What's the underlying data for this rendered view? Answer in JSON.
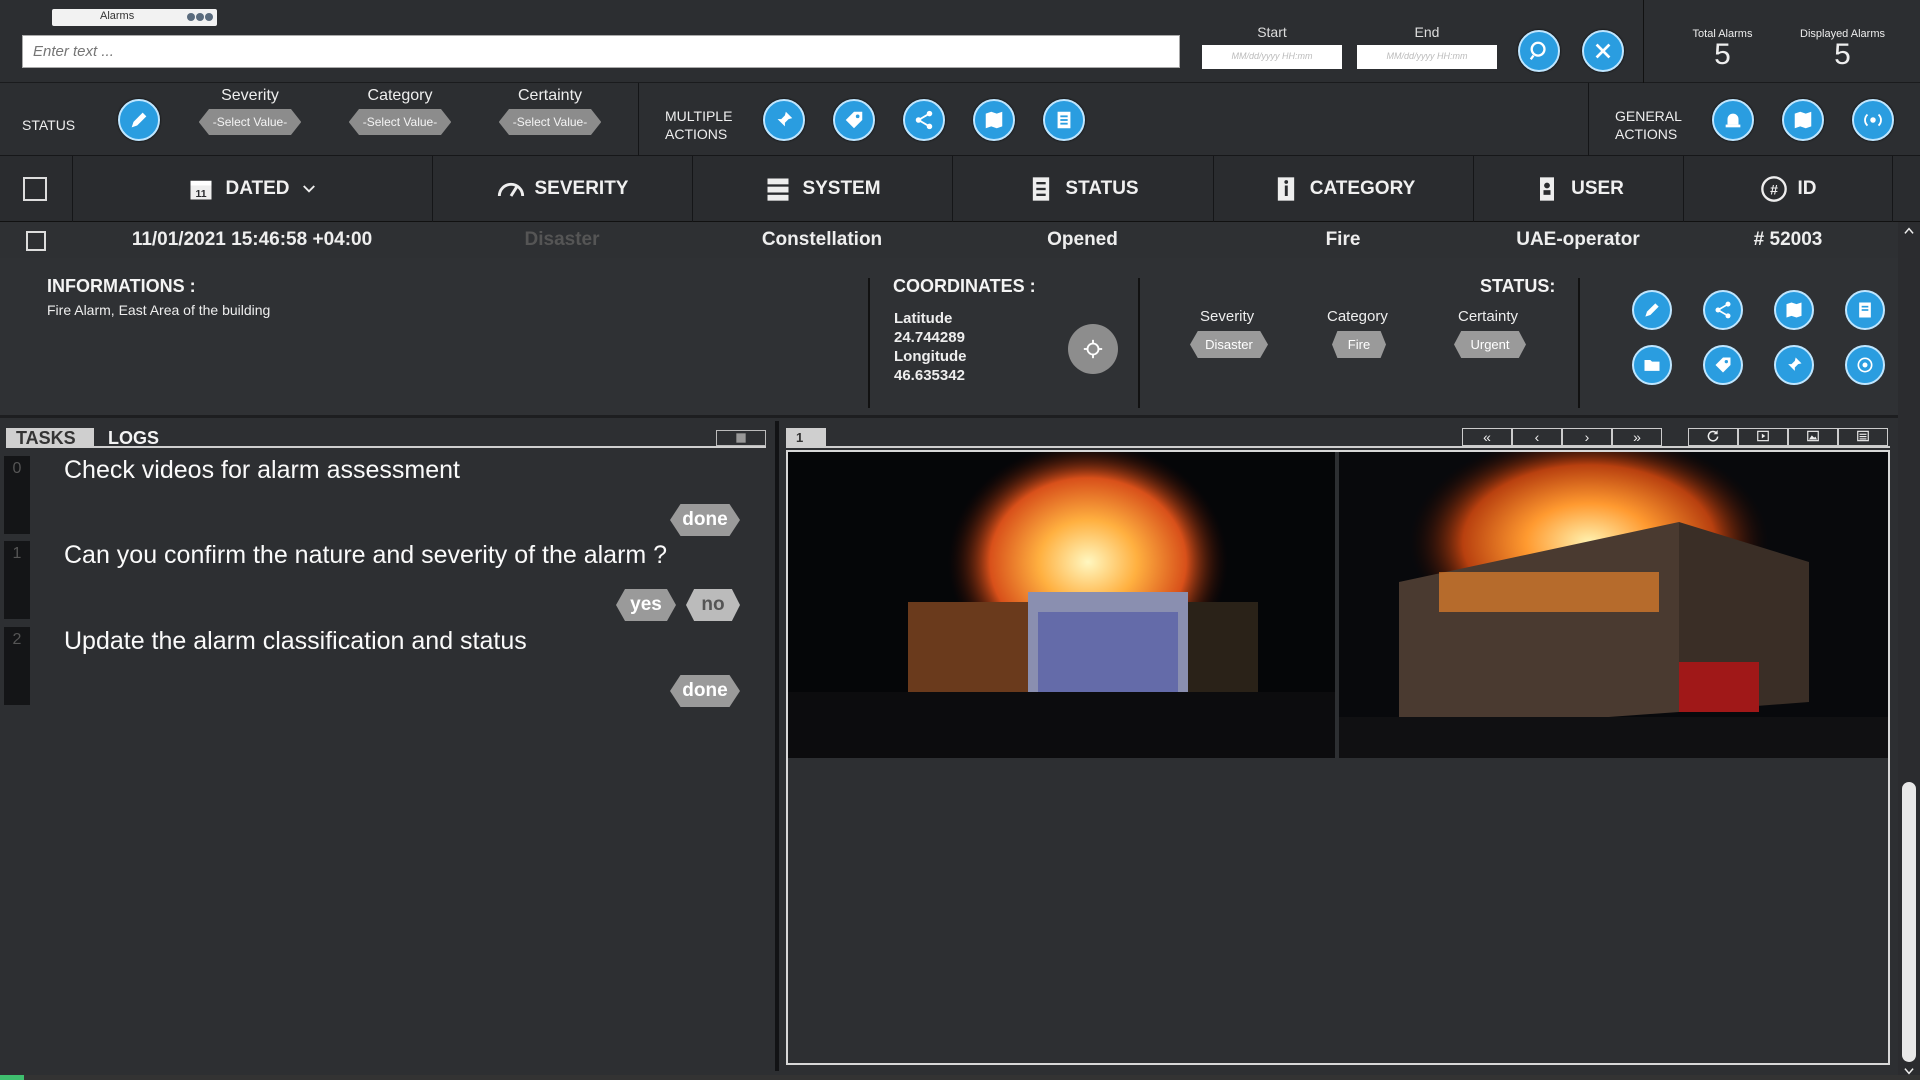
{
  "top": {
    "tab_label": "Alarms",
    "search_placeholder": "Enter text ...",
    "start_label": "Start",
    "end_label": "End",
    "start_placeholder": "MM/dd/yyyy HH:mm",
    "end_placeholder": "MM/dd/yyyy HH:mm",
    "total_alarms_label": "Total Alarms",
    "total_alarms": "5",
    "displayed_alarms_label": "Displayed Alarms",
    "displayed_alarms": "5"
  },
  "actions": {
    "status_label": "STATUS",
    "severity_label": "Severity",
    "category_label": "Category",
    "certainty_label": "Certainty",
    "select_value": "-Select Value-",
    "multiple_actions_1": "MULTIPLE",
    "multiple_actions_2": "ACTIONS",
    "general_actions_1": "GENERAL",
    "general_actions_2": "ACTIONS"
  },
  "columns": {
    "dated": "DATED",
    "calendar_day": "11",
    "severity": "SEVERITY",
    "system": "SYSTEM",
    "status": "STATUS",
    "category": "CATEGORY",
    "user": "USER",
    "id": "ID"
  },
  "alarm": {
    "date": "11/01/2021 15:46:58 +04:00",
    "severity": "Disaster",
    "system": "Constellation",
    "status": "Opened",
    "category": "Fire",
    "user": "UAE-operator",
    "id": "# 52003"
  },
  "details": {
    "info_title": "INFORMATIONS :",
    "info_text": "Fire Alarm, East Area of the building",
    "coords_title": "COORDINATES :",
    "lat_label": "Latitude",
    "lat_value": "24.744289",
    "lon_label": "Longitude",
    "lon_value": "46.635342",
    "status_title": "STATUS:",
    "severity_label": "Severity",
    "severity_value": "Disaster",
    "category_label": "Category",
    "category_value": "Fire",
    "certainty_label": "Certainty",
    "certainty_value": "Urgent"
  },
  "tasks": {
    "tab_tasks": "TASKS",
    "tab_logs": "LOGS",
    "items": [
      {
        "num": "0",
        "text": "Check videos for alarm assessment",
        "btn": "done"
      },
      {
        "num": "1",
        "text": "Can you confirm the nature and severity of the alarm ?",
        "yes": "yes",
        "no": "no"
      },
      {
        "num": "2",
        "text": "Update the alarm classification and status",
        "btn": "done"
      }
    ]
  },
  "media": {
    "tab": "1",
    "nav_first": "«",
    "nav_prev": "‹",
    "nav_next": "›",
    "nav_last": "»"
  },
  "colors": {
    "accent": "#2a9de0",
    "background": "#2d2f32",
    "pill": "#8c8c8c"
  }
}
